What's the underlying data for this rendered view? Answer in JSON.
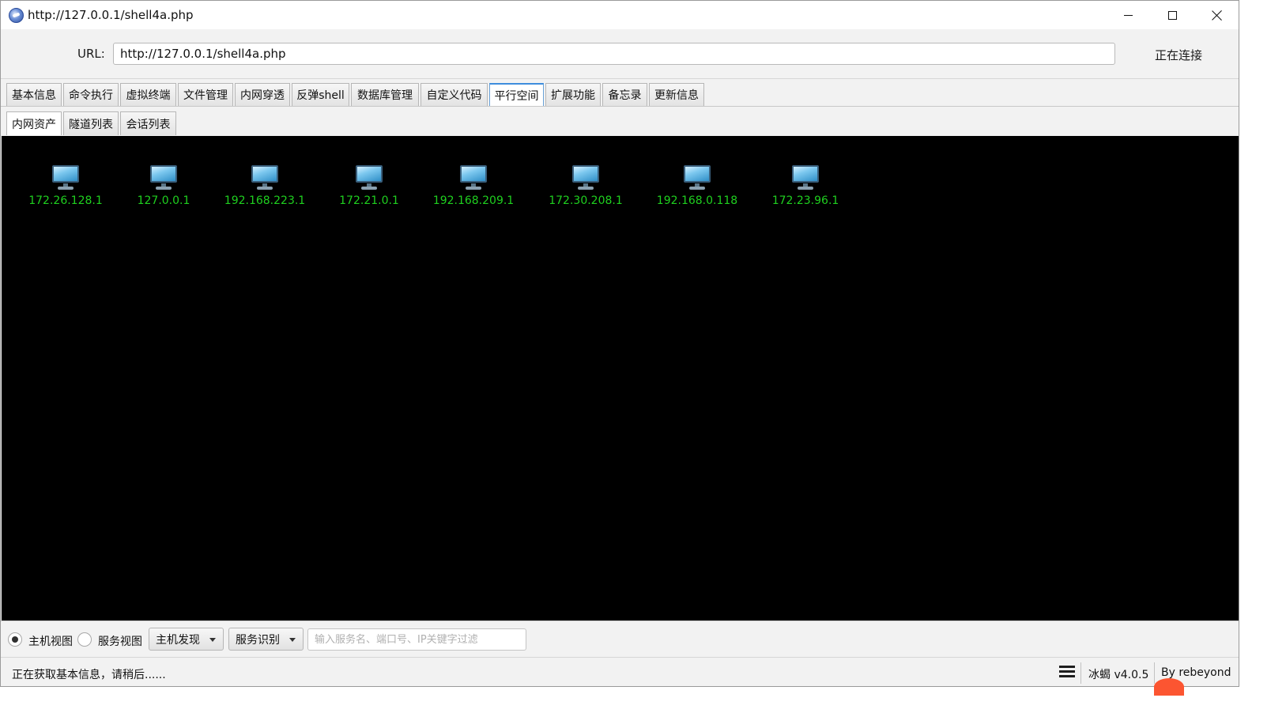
{
  "window": {
    "title": "http://127.0.0.1/shell4a.php"
  },
  "urlbar": {
    "label": "URL:",
    "value": "http://127.0.0.1/shell4a.php",
    "status": "正在连接"
  },
  "tabs": [
    {
      "label": "基本信息"
    },
    {
      "label": "命令执行"
    },
    {
      "label": "虚拟终端"
    },
    {
      "label": "文件管理"
    },
    {
      "label": "内网穿透"
    },
    {
      "label": "反弹shell"
    },
    {
      "label": "数据库管理"
    },
    {
      "label": "自定义代码"
    },
    {
      "label": "平行空间",
      "active": true
    },
    {
      "label": "扩展功能"
    },
    {
      "label": "备忘录"
    },
    {
      "label": "更新信息"
    }
  ],
  "subtabs": [
    {
      "label": "内网资产",
      "active": true
    },
    {
      "label": "隧道列表"
    },
    {
      "label": "会话列表"
    }
  ],
  "hosts": [
    {
      "ip": "172.26.128.1"
    },
    {
      "ip": "127.0.0.1"
    },
    {
      "ip": "192.168.223.1"
    },
    {
      "ip": "172.21.0.1"
    },
    {
      "ip": "192.168.209.1"
    },
    {
      "ip": "172.30.208.1"
    },
    {
      "ip": "192.168.0.118"
    },
    {
      "ip": "172.23.96.1"
    }
  ],
  "toolbar": {
    "host_view_label": "主机视图",
    "service_view_label": "服务视图",
    "host_discovery_label": "主机发现",
    "service_identify_label": "服务识别",
    "filter_placeholder": "输入服务名、端口号、IP关键字过滤"
  },
  "statusbar": {
    "message": "正在获取基本信息，请稍后......",
    "version": "冰蝎 v4.0.5",
    "author": "By rebeyond"
  },
  "colors": {
    "host_ip_text": "#1fd01f",
    "canvas_bg": "#000000",
    "active_tab_border": "#3e8ddd"
  }
}
